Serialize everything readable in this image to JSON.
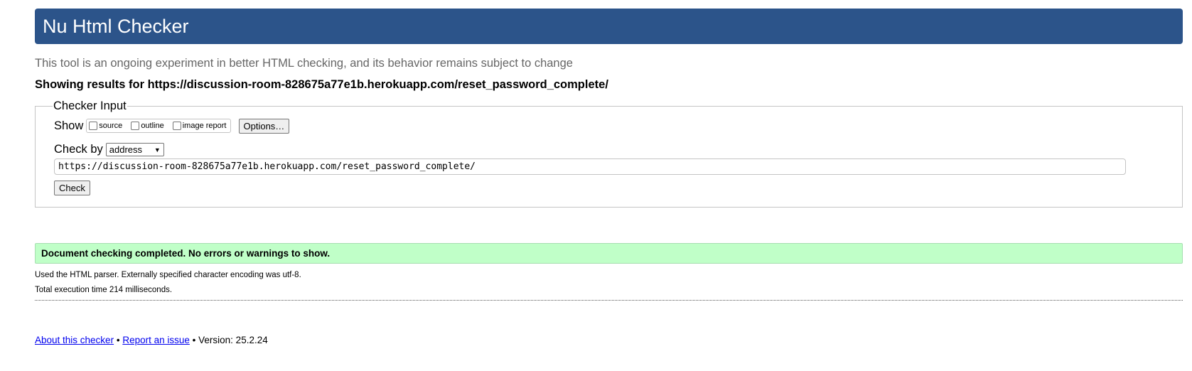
{
  "header": {
    "title": "Nu Html Checker",
    "subtitle": "This tool is an ongoing experiment in better HTML checking, and its behavior remains subject to change",
    "results_for": "Showing results for https://discussion-room-828675a77e1b.herokuapp.com/reset_password_complete/"
  },
  "checker_input": {
    "legend": "Checker Input",
    "show_label": "Show",
    "show_options": [
      {
        "label": "source",
        "checked": false
      },
      {
        "label": "outline",
        "checked": false
      },
      {
        "label": "image report",
        "checked": false
      }
    ],
    "options_button": "Options…",
    "check_by_label": "Check by",
    "check_by_selected": "address",
    "url_value": "https://discussion-room-828675a77e1b.herokuapp.com/reset_password_complete/",
    "check_button": "Check"
  },
  "result": {
    "message": "Document checking completed. No errors or warnings to show.",
    "parser_info": "Used the HTML parser. Externally specified character encoding was utf-8.",
    "execution_time": "Total execution time 214 milliseconds."
  },
  "footer": {
    "about_link": "About this checker",
    "separator": "•",
    "report_link": "Report an issue",
    "version": "Version: 25.2.24"
  },
  "colors": {
    "title_bar": "#2c548a",
    "success_bg": "#c0ffc8",
    "link": "#0000ee"
  },
  "icons": {
    "select_arrow": "chevron-down-icon"
  }
}
